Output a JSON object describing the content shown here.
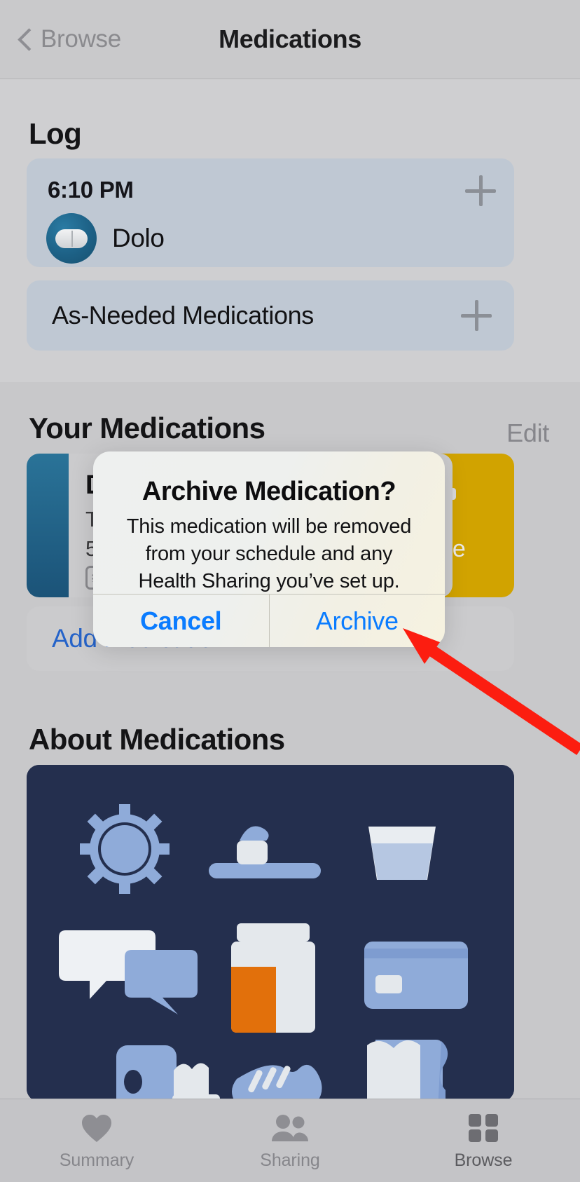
{
  "nav": {
    "back_label": "Browse",
    "title": "Medications",
    "back_icon": "chevron-left-icon"
  },
  "log": {
    "heading": "Log",
    "entry": {
      "time": "6:10 PM",
      "medication": "Dolo",
      "add_icon": "plus-icon",
      "avatar_icon": "capsule-pill-icon"
    },
    "as_needed": {
      "label": "As-Needed Medications",
      "add_icon": "plus-icon"
    }
  },
  "your_medications": {
    "heading": "Your Medications",
    "edit_label": "Edit",
    "medication": {
      "name": "D",
      "line1": "T",
      "line2": "5",
      "detail_icon": "pill-box-icon"
    },
    "swipe_action": {
      "label": "rchive",
      "full_label": "Archive",
      "icon": "archive-box-icon",
      "color": "#d1a300"
    },
    "add_label": "Add Medication"
  },
  "about": {
    "heading": "About Medications",
    "card_background": "#242f4e"
  },
  "alert": {
    "title": "Archive Medication?",
    "message": "This medication will be removed from your schedule and any Health Sharing you’ve set up.",
    "cancel_label": "Cancel",
    "confirm_label": "Archive",
    "tint_color": "#0a7cff"
  },
  "tabbar": {
    "items": [
      {
        "label": "Summary",
        "icon": "heart-icon",
        "selected": false
      },
      {
        "label": "Sharing",
        "icon": "two-people-icon",
        "selected": false
      },
      {
        "label": "Browse",
        "icon": "grid-squares-icon",
        "selected": true
      }
    ]
  },
  "annotation": {
    "arrow_color": "#fc1d10",
    "points_to": "Archive"
  }
}
